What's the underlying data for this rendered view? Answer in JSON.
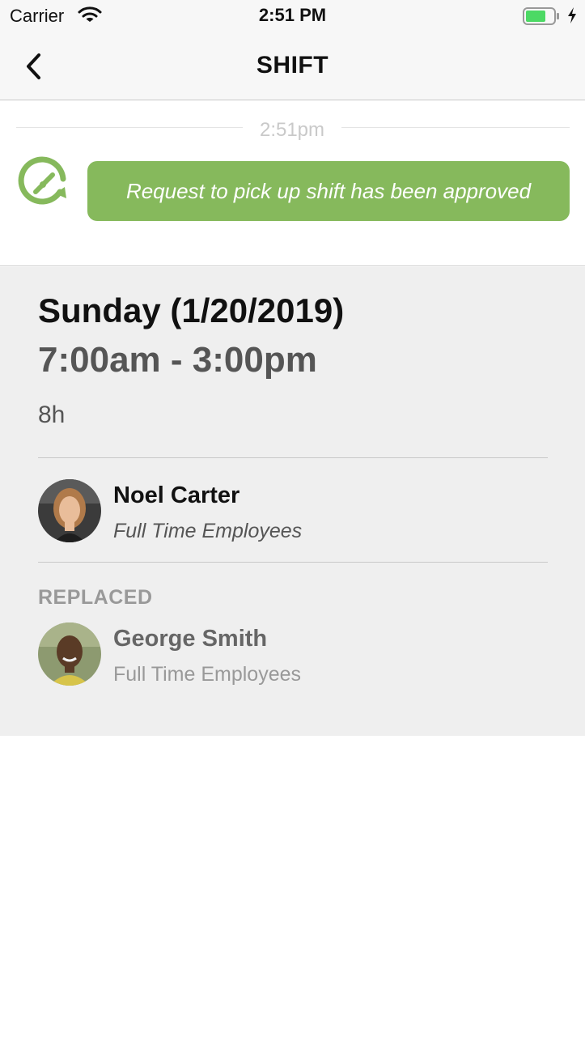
{
  "status_bar": {
    "carrier": "Carrier",
    "time": "2:51 PM",
    "battery_color": "#4cd964"
  },
  "nav": {
    "title": "SHIFT",
    "back_icon": "chevron-left-icon"
  },
  "message": {
    "timestamp": "2:51pm",
    "text": "Request to pick up shift has been approved",
    "bubble_color": "#86b95c",
    "icon": "clock-refresh-icon"
  },
  "shift": {
    "day": "Sunday (1/20/2019)",
    "time_range": "7:00am - 3:00pm",
    "duration": "8h",
    "assignee": {
      "name": "Noel Carter",
      "group": "Full Time Employees"
    },
    "replaced_label": "REPLACED",
    "replaced": {
      "name": "George Smith",
      "group": "Full Time Employees"
    }
  }
}
